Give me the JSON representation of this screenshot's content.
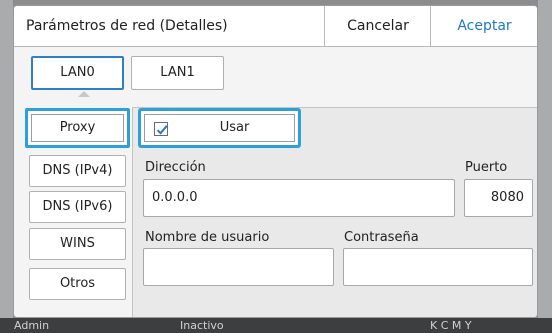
{
  "dialog": {
    "title": "Parámetros de red (Detalles)",
    "cancel_label": "Cancelar",
    "accept_label": "Aceptar"
  },
  "tabs": [
    {
      "label": "LAN0",
      "active": true
    },
    {
      "label": "LAN1",
      "active": false
    }
  ],
  "sidebar": {
    "items": [
      {
        "label": "Proxy",
        "selected": true
      },
      {
        "label": "DNS (IPv4)",
        "selected": false
      },
      {
        "label": "DNS (IPv6)",
        "selected": false
      },
      {
        "label": "WINS",
        "selected": false
      },
      {
        "label": "Otros",
        "selected": false
      }
    ]
  },
  "proxy": {
    "use_label": "Usar",
    "use_checked": true,
    "address_label": "Dirección",
    "address_value": "0.0.0.0",
    "port_label": "Puerto",
    "port_value": "8080",
    "username_label": "Nombre de usuario",
    "username_value": "",
    "password_label": "Contraseña",
    "password_value": ""
  },
  "background": {
    "footer_left": "Admin",
    "footer_mid": "Inactivo",
    "footer_right": "K C M Y"
  },
  "colors": {
    "accent": "#1f78c8",
    "highlight_border": "#2ea0d8",
    "tab_border": "#2e7fc6"
  }
}
